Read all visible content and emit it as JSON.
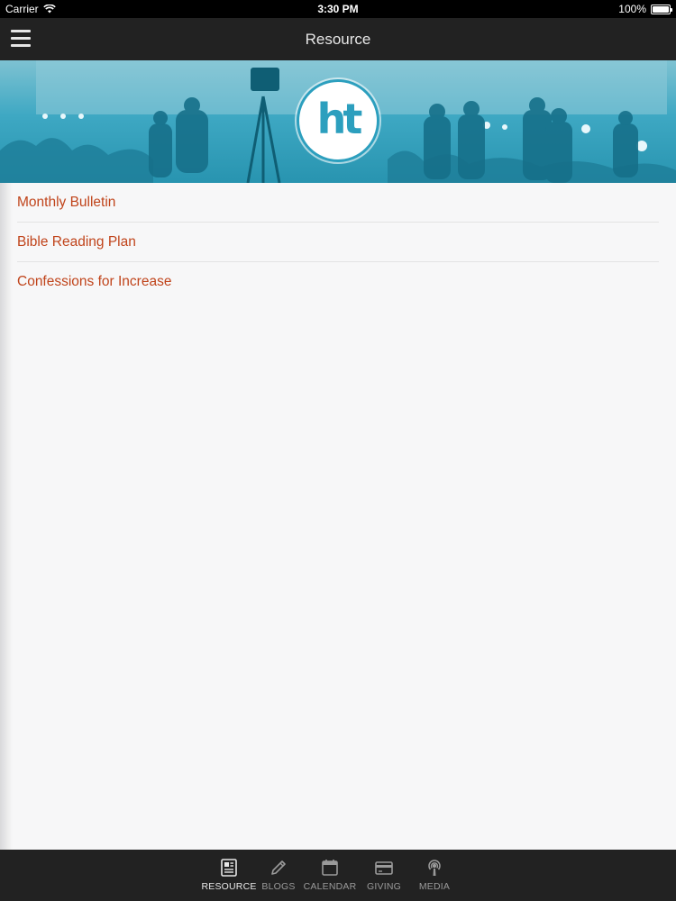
{
  "status_bar": {
    "carrier": "Carrier",
    "time": "3:30 PM",
    "battery": "100%",
    "battery_level": 1.0,
    "wifi_icon": "wifi-icon"
  },
  "nav_bar": {
    "title": "Resource",
    "menu_icon": "hamburger-menu-icon"
  },
  "banner": {
    "logo_text": "ht",
    "tint_color": "#2c9fbe"
  },
  "resources": {
    "items": [
      {
        "label": "Monthly Bulletin"
      },
      {
        "label": "Bible Reading Plan"
      },
      {
        "label": "Confessions for Increase"
      }
    ],
    "link_color": "#c0441b"
  },
  "tab_bar": {
    "tabs": [
      {
        "label": "RESOURCE",
        "icon": "document-icon",
        "active": true
      },
      {
        "label": "BLOGS",
        "icon": "pencil-icon",
        "active": false
      },
      {
        "label": "CALENDAR",
        "icon": "calendar-icon",
        "active": false
      },
      {
        "label": "GIVING",
        "icon": "credit-card-icon",
        "active": false
      },
      {
        "label": "MEDIA",
        "icon": "podcast-icon",
        "active": false
      }
    ]
  }
}
